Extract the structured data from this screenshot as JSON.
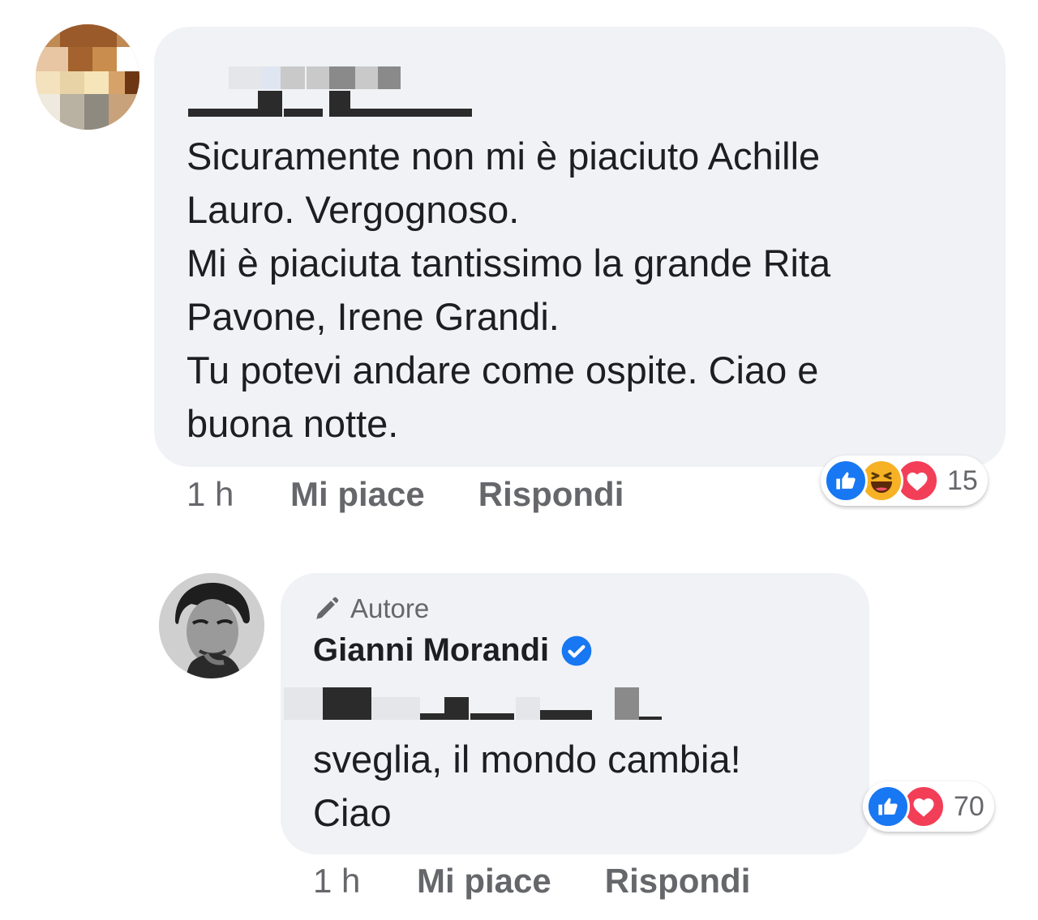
{
  "colors": {
    "bubble_background": "#f0f2f5",
    "secondary_text": "#65676b",
    "primary_text": "#1c1e21",
    "like_blue": "#1877f2",
    "love_red": "#f33e58",
    "haha_yellow": "#f7b125",
    "verified_blue": "#1877f2"
  },
  "comments": [
    {
      "avatar_icon": "pixelated-avatar",
      "author_name_redacted": true,
      "text_lines": [
        "Sicuramente non mi è piaciuto Achille",
        "Lauro. Vergognoso.",
        "Mi è piaciuta tantissimo la grande Rita",
        "Pavone, Irene Grandi.",
        "Tu potevi andare come ospite. Ciao e",
        "buona notte."
      ],
      "time": "1 h",
      "like_label": "Mi piace",
      "reply_label": "Rispondi",
      "reaction_icons": [
        "like-icon",
        "haha-icon",
        "love-icon"
      ],
      "reaction_count": "15"
    },
    {
      "avatar_icon": "author-avatar",
      "author_badge_icon": "pen-icon",
      "author_badge_label": "Autore",
      "author_name": "Gianni Morandi",
      "verified_icon": "verified-badge-icon",
      "mention_redacted": true,
      "text_lines": [
        "sveglia, il mondo cambia!",
        "Ciao"
      ],
      "time": "1 h",
      "like_label": "Mi piace",
      "reply_label": "Rispondi",
      "reaction_icons": [
        "like-icon",
        "love-icon"
      ],
      "reaction_count": "70"
    }
  ]
}
